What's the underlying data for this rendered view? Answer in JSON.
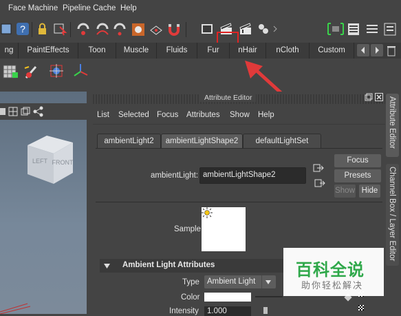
{
  "menubar": {
    "items": [
      "Face Machine",
      "Pipeline Cache",
      "Help"
    ]
  },
  "shelf_tabs": [
    "ng",
    "PaintEffects",
    "Toon",
    "Muscle",
    "Fluids",
    "Fur",
    "nHair",
    "nCloth",
    "Custom"
  ],
  "viewcube": {
    "left_label": "LEFT",
    "front_label": "FRONT"
  },
  "attribute_editor": {
    "title": "Attribute Editor",
    "menu": [
      "List",
      "Selected",
      "Focus",
      "Attributes",
      "Show",
      "Help"
    ],
    "tabs": [
      "ambientLight2",
      "ambientLightShape2",
      "defaultLightSet"
    ],
    "active_tab": "ambientLightShape2",
    "node_label": "ambientLight:",
    "node_value": "ambientLightShape2",
    "buttons": {
      "focus": "Focus",
      "presets": "Presets",
      "show": "Show",
      "hide": "Hide"
    },
    "sample_label": "Sample",
    "section_title": "Ambient Light Attributes",
    "type_label": "Type",
    "type_value": "Ambient Light",
    "color_label": "Color",
    "color_value": "#ffffff",
    "intensity_label": "Intensity",
    "intensity_value": "1.000"
  },
  "side_tabs": [
    "Attribute Editor",
    "Channel Box / Layer Editor"
  ],
  "watermark": {
    "title": "百科全说",
    "subtitle": "助你轻松解决"
  },
  "colors": {
    "highlight_red": "#e03a3a",
    "accent_green": "#39d24a"
  }
}
